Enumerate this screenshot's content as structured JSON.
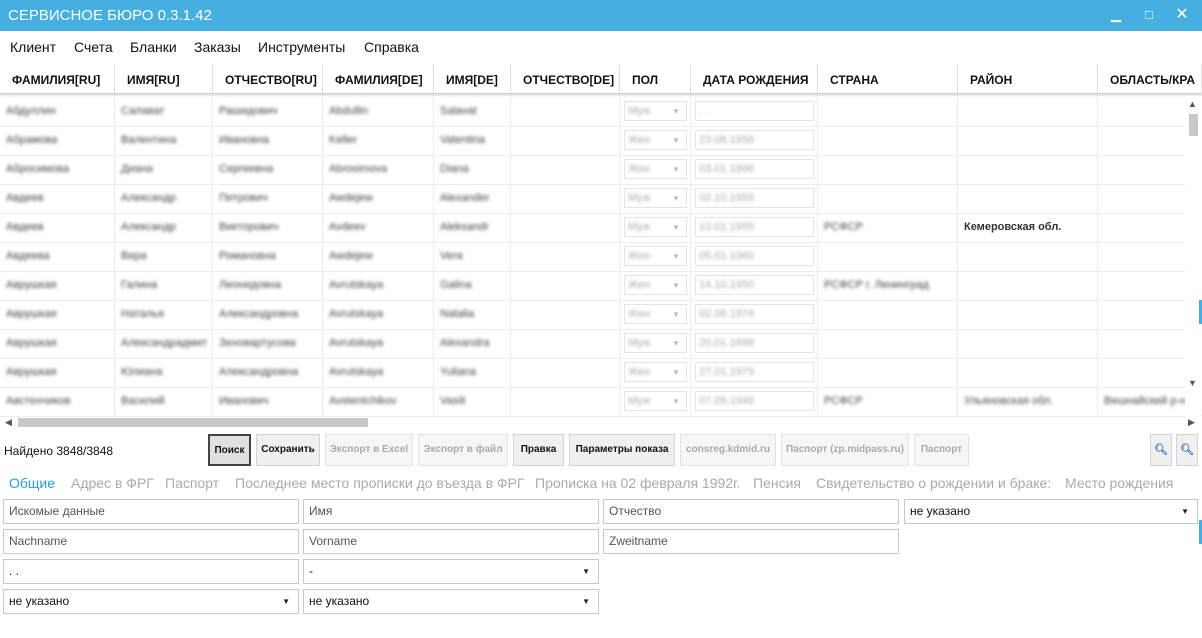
{
  "window": {
    "title": "СЕРВИСНОЕ БЮРО 0.3.1.42"
  },
  "menu": [
    "Клиент",
    "Счета",
    "Бланки",
    "Заказы",
    "Инструменты",
    "Справка"
  ],
  "columns": [
    "ФАМИЛИЯ[RU]",
    "ИМЯ[RU]",
    "ОТЧЕСТВО[RU]",
    "ФАМИЛИЯ[DE]",
    "ИМЯ[DE]",
    "ОТЧЕСТВО[DE]",
    "ПОЛ",
    "ДАТА РОЖДЕНИЯ",
    "СТРАНА",
    "РАЙОН",
    "ОБЛАСТЬ/КРА"
  ],
  "rows": [
    [
      "Абдуллин",
      "Салават",
      "Рашидович",
      "Abdullin",
      "Salavat",
      "",
      "Муж",
      ". .",
      "",
      "",
      ""
    ],
    [
      "Абрамова",
      "Валентина",
      "Ивановна",
      "Keller",
      "Valentina",
      "",
      "Жен",
      "23.08.1958",
      "",
      "",
      ""
    ],
    [
      "Абросимова",
      "Диана",
      "Сергеевна",
      "Abrosimova",
      "Diana",
      "",
      "Жен",
      "03.01.1996",
      "",
      "",
      ""
    ],
    [
      "Авдеев",
      "Александр",
      "Петрович",
      "Awdejew",
      "Alexander",
      "",
      "Муж",
      "02.10.1959",
      "",
      "",
      ""
    ],
    [
      "Авдеев",
      "Александр",
      "Викторович",
      "Avdeev",
      "Aleksandr",
      "",
      "Муж",
      "10.01.1955",
      "РСФСР",
      "Кемеровская обл.",
      ""
    ],
    [
      "Авдеева",
      "Вера",
      "Романовна",
      "Awdejew",
      "Vera",
      "",
      "Жен",
      "05.01.1960",
      "",
      "",
      ""
    ],
    [
      "Аврушкая",
      "Галина",
      "Леонидовна",
      "Avrutskaya",
      "Galina",
      "",
      "Жен",
      "14.10.1950",
      "РСФСР г. Ленинград",
      "",
      ""
    ],
    [
      "Аврушкая",
      "Наталья",
      "Александровна",
      "Avrutskaya",
      "Natalia",
      "",
      "Жен",
      "02.08.1974",
      "",
      "",
      ""
    ],
    [
      "Аврушкая",
      "Александрадмит",
      "Зеновартусова",
      "Avrutskaya",
      "Alexandra",
      "",
      "Муж",
      "20.01.1998",
      "",
      "",
      ""
    ],
    [
      "Аврушкая",
      "Юлиана",
      "Александровна",
      "Avrutskaya",
      "Yuliana",
      "",
      "Жен",
      "27.01.1979",
      "",
      "",
      ""
    ],
    [
      "Австенчиков",
      "Василий",
      "Иванович",
      "Avstentchikov",
      "Vasili",
      "",
      "Муж",
      "07.09.1949",
      "РСФСР",
      "Ульяновская обл.",
      "Вешнайский р-н"
    ]
  ],
  "toolbar": {
    "found": "Найдено 3848/3848",
    "buttons": [
      {
        "label": "Поиск",
        "state": "active"
      },
      {
        "label": "Сохранить",
        "state": "enabled"
      },
      {
        "label": "Экспорт в Excel",
        "state": "disabled"
      },
      {
        "label": "Экспорт в файл",
        "state": "disabled"
      },
      {
        "label": "Правка",
        "state": "enabled"
      },
      {
        "label": "Параметры показа",
        "state": "enabled"
      },
      {
        "label": "consreg.kdmid.ru",
        "state": "disabled"
      },
      {
        "label": "Паспорт (zp.midpass.ru)",
        "state": "disabled"
      },
      {
        "label": "Паспорт",
        "state": "disabled"
      }
    ]
  },
  "tabs": [
    "Общие",
    "Адрес в ФРГ",
    "Паспорт",
    "Последнее место прописки до въезда в ФРГ",
    "Прописка на 02 февраля 1992г.",
    "Пенсия",
    "Свидетельство о рождении и браке:",
    "Место рождения"
  ],
  "form": {
    "search_data": "Искомые данные",
    "first_name_ru": "Имя",
    "patronymic_ru": "Отчество",
    "gender": "не указано",
    "nachname": "Nachname",
    "vorname": "Vorname",
    "zweitname": "Zweitname",
    "date": ". .",
    "select_dash": "-",
    "select_a": "не указано",
    "select_b": "не указано"
  },
  "colors": {
    "accent": "#45b0e0",
    "tab_selected": "#2b9ed8"
  }
}
